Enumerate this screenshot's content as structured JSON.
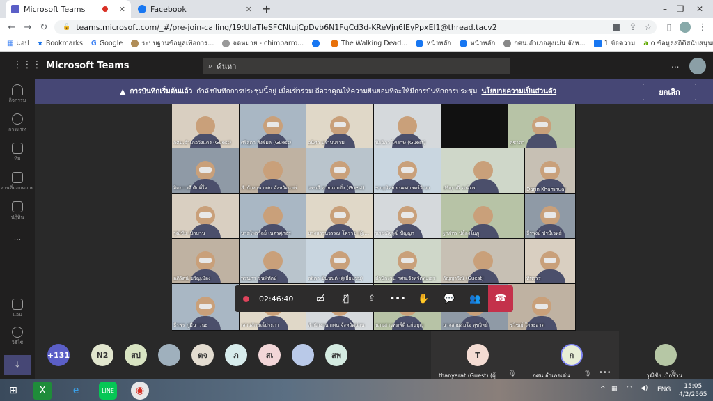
{
  "browser": {
    "tabs": [
      {
        "title": "Microsoft Teams",
        "recording": true,
        "active": true
      },
      {
        "title": "Facebook",
        "active": false
      }
    ],
    "new_tab": "+",
    "url": "teams.microsoft.com/_#/pre-join-calling/19:UlaTleSFCNtujCpDvb6N1FqCd3d-KReVjn6lEyPpxEl1@thread.tacv2",
    "bookmarks": [
      "แอป",
      "Bookmarks",
      "Google",
      "ระบบฐานข้อมูลเพื่อการ...",
      "จดหมาย - chimparro...",
      "",
      "The Walking Dead...",
      "หน้าหลัก",
      "หน้าหลัก",
      "กศน.อำเภอสูงเม่น จังห...",
      "1 ข้อความ",
      "o ข้อมูลสถิติสนับสนุนแผนติด..."
    ]
  },
  "teams": {
    "app_title": "Microsoft Teams",
    "search_placeholder": "ค้นหา",
    "more": "...",
    "rail": [
      "กิจกรรม",
      "การแชท",
      "ทีม",
      "งานที่มอบหมาย",
      "ปฏิทิน",
      "...",
      "แอป",
      "วิธีใช้"
    ],
    "banner": {
      "bold": "การบันทึกเริ่มต้นแล้ว",
      "text": "กำลังบันทึกการประชุมนี้อยู่ เมื่อเข้าร่วม ถือว่าคุณให้ความยินยอมที่จะให้มีการบันทึกการประชุม",
      "link": "นโยบายความเป็นส่วนตัว",
      "dismiss": "ยกเลิก"
    },
    "grid_tiles": [
      "กศน.อำเภอวังแดง (Guest)",
      "ศรีสุดา สังข์ผล (Guest)",
      "อนิศา ปราบปราม",
      "นิรวิภา โคราษ (Guest)",
      "สุชาดา",
      "จิตภาวดี ศักดิ์ใจ",
      "ลำนักงาน กศน.จังหวัดแพร่",
      "วรรณี สายแถมยั่ง (Guest)",
      "ชาญวิทย์ ยนตศาสตร์วิเวก",
      "ปรัญาณี จงจิตร",
      "Darin Khamnual",
      "วุฒิชัย เบิกบาน",
      "นายไพรวัลย์ เนตรศุภอร",
      "นางสาวนวรรณ โคราช (ผู้เ...",
      "นายณัฐวุฒิ ปัญญา",
      "ฐาภัทร ปล้องโบฏุ",
      "ธีรพงษ์ ปรมีเวทย์",
      "อภิรัตน์ ขวัญเมือง",
      "พรนภา ขุนพิทักษ์",
      "ลลิตา ชิ่นชนต์ (ผู้เยี่ยมชม)",
      "สำนักงาน กศน.จังหวัดพะเยา",
      "กัญญาวีณ์ (Guest)",
      "ทิพวรร",
      "ธีรพร ภูมีนาวนะ",
      "เสาวลักษณ์ประภา",
      "ลำนักงาน กศน.จังหวัดน่าน",
      "นายสาวพิมพ์ดี แก่นบุญ",
      "นางสายสมใจ สุขวิทย์",
      "ชวิชญ์ ใสสะอาด"
    ],
    "controls": {
      "timer": "02:46:40",
      "record_icon": "record-icon",
      "buttons": [
        "camera-off-icon",
        "mic-off-icon",
        "share-icon",
        "more-icon",
        "raise-hand-icon",
        "chat-icon",
        "participants-icon"
      ],
      "hangup": "hangup-icon"
    },
    "participants": {
      "overflow": "+131",
      "avatars": [
        {
          "initials": "N2",
          "color": "#e1e6ce"
        },
        {
          "initials": "สป",
          "color": "#d8e4c2"
        },
        {
          "initials": "",
          "color": "#9fb0bd",
          "photo": true
        },
        {
          "initials": "ตจ",
          "color": "#e3dcd0"
        },
        {
          "initials": "ภ",
          "color": "#d7ecec"
        },
        {
          "initials": "สเ",
          "color": "#f2d6d8"
        },
        {
          "initials": "",
          "color": "#b9c9e8",
          "photo": true
        },
        {
          "initials": "สพ",
          "color": "#d4ebe1"
        }
      ],
      "speakers": [
        {
          "initials": "T",
          "name": "thanyarat (Guest) (ผู้...",
          "color": "#f4dcd3"
        },
        {
          "initials": "ก",
          "name": "กศน.อำเภอเด่น...",
          "color": "#e8eed6"
        }
      ],
      "self_name": "วุฒิชัย เบิกบาน"
    }
  },
  "taskbar": {
    "lang": "ENG",
    "time": "15:05",
    "date": "4/2/2565"
  },
  "colors": {
    "teams_purple": "#464775",
    "hangup_red": "#c4314b",
    "dark_bg": "#292929"
  }
}
